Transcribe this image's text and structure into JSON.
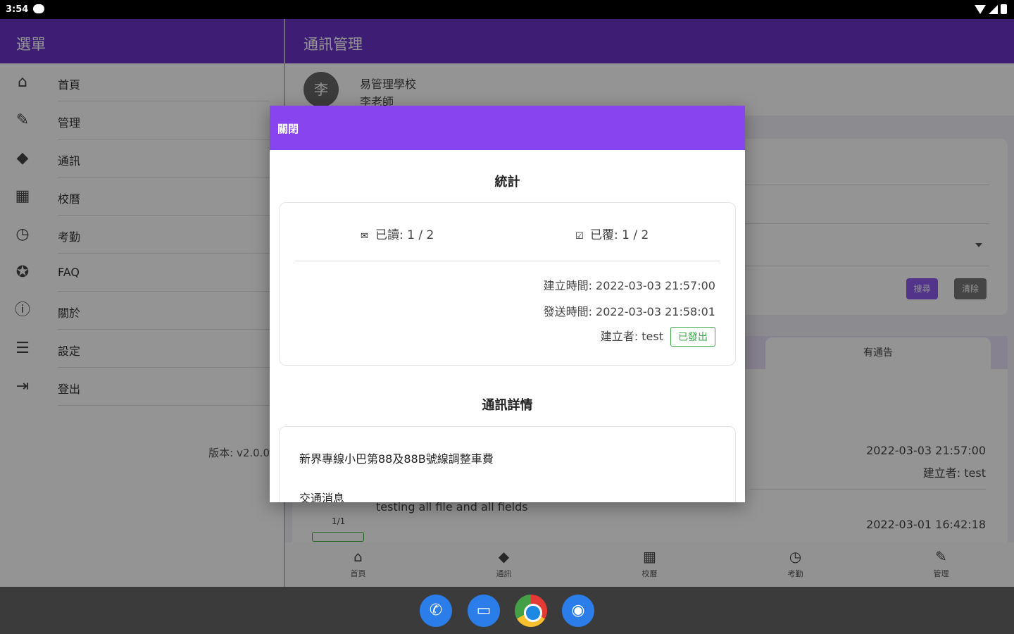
{
  "status_bar": {
    "time": "3:54"
  },
  "drawer": {
    "title": "選單",
    "items": [
      {
        "icon": "home-icon",
        "glyph": "⌂",
        "label": "首頁"
      },
      {
        "icon": "wrench-icon",
        "glyph": "✎",
        "label": "管理"
      },
      {
        "icon": "bell-icon",
        "glyph": "◆",
        "label": "通訊"
      },
      {
        "icon": "calendar-icon",
        "glyph": "▦",
        "label": "校曆"
      },
      {
        "icon": "clock-icon",
        "glyph": "◷",
        "label": "考勤"
      },
      {
        "icon": "lifebuoy-icon",
        "glyph": "✪",
        "label": "FAQ"
      },
      {
        "icon": "info-icon",
        "glyph": "ⓘ",
        "label": "關於"
      },
      {
        "icon": "sliders-icon",
        "glyph": "☰",
        "label": "設定"
      },
      {
        "icon": "logout-icon",
        "glyph": "⇥",
        "label": "登出"
      }
    ],
    "version": "版本: v2.0.0"
  },
  "main": {
    "title": "通訊管理",
    "profile": {
      "avatar_text": "李",
      "school": "易管理學校",
      "teacher": "李老師"
    },
    "buttons": {
      "search": "搜尋",
      "clear": "清除"
    },
    "tab_label": "有通告",
    "list": [
      {
        "date": "2022-03-03 21:57:00",
        "creator": "建立者: test"
      },
      {
        "subject": "testing all file and all fields",
        "count": "1/1",
        "date": "2022-03-01 16:42:18"
      }
    ]
  },
  "bottom_nav": [
    {
      "icon": "home-icon",
      "glyph": "⌂",
      "label": "首頁"
    },
    {
      "icon": "bell-icon",
      "glyph": "◆",
      "label": "通訊"
    },
    {
      "icon": "calendar-icon",
      "glyph": "▦",
      "label": "校曆"
    },
    {
      "icon": "clock-icon",
      "glyph": "◷",
      "label": "考勤"
    },
    {
      "icon": "wrench-icon",
      "glyph": "✎",
      "label": "管理"
    }
  ],
  "dialog": {
    "header": "關閉",
    "stats_title": "統計",
    "read": "已讀: 1 / 2",
    "replied": "已覆: 1 / 2",
    "created_time": "建立時間: 2022-03-03 21:57:00",
    "sent_time": "發送時間: 2022-03-03 21:58:01",
    "creator": "建立者: test",
    "status_tag": "已發出",
    "detail_title": "通訊詳情",
    "subject": "新界專線小巴第88及88B號線調整車費",
    "category": "交通消息"
  }
}
